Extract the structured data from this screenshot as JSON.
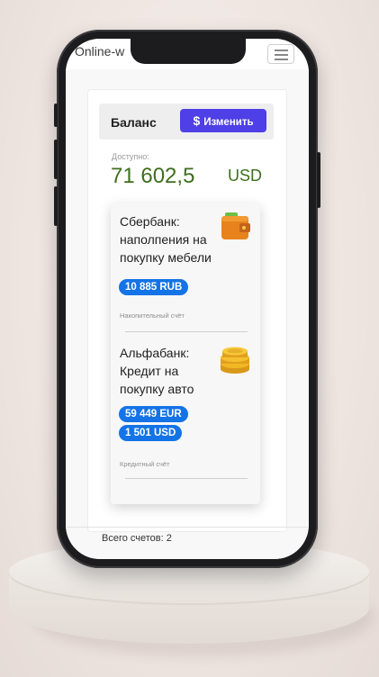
{
  "app": {
    "title": "Online-w"
  },
  "balance": {
    "title": "Баланс",
    "change_button": "Изменить",
    "change_icon": "$"
  },
  "available": {
    "label": "Доступно:",
    "amount": "71 602,5",
    "currency": "USD"
  },
  "accounts": [
    {
      "name_lines": [
        "Сбербанк:",
        "наполпения на",
        "покупку мебели"
      ],
      "balances": [
        "10 885 RUB"
      ],
      "type": "Накопительный счёт",
      "icon": "wallet-icon"
    },
    {
      "name_lines": [
        "Альфабанк:",
        "Кредит на",
        "покупку авто"
      ],
      "balances": [
        "59 449 EUR",
        "1 501 USD"
      ],
      "type": "Кредитный счёт",
      "icon": "coins-icon"
    }
  ],
  "footer": {
    "total": "Всего счетов: 2"
  },
  "colors": {
    "accent": "#4e3fe6",
    "pill": "#1473e6",
    "amount": "#3e6f1f"
  }
}
